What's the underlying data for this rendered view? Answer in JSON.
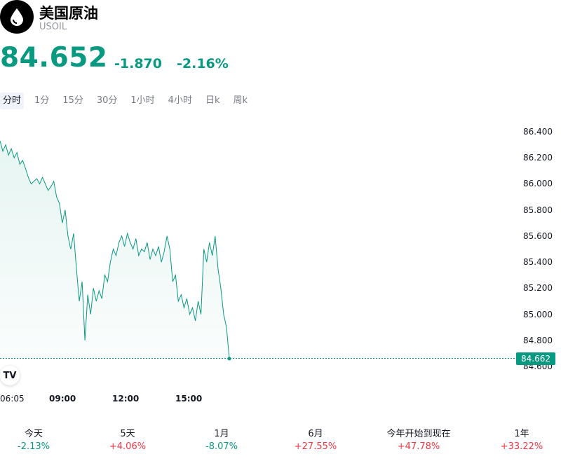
{
  "header": {
    "title": "美国原油",
    "symbol": "USOIL",
    "logo_icon": "oil-drop-icon"
  },
  "quote": {
    "price": "84.652",
    "change": "-1.870",
    "change_percent": "-2.16%",
    "color": "#089981"
  },
  "tabs": [
    {
      "label": "分时",
      "active": true
    },
    {
      "label": "1分",
      "active": false
    },
    {
      "label": "15分",
      "active": false
    },
    {
      "label": "30分",
      "active": false
    },
    {
      "label": "1小时",
      "active": false
    },
    {
      "label": "4小时",
      "active": false
    },
    {
      "label": "日k",
      "active": false
    },
    {
      "label": "周k",
      "active": false
    }
  ],
  "chart_data": {
    "type": "area",
    "line_color": "#089981",
    "y_ticks": [
      "86.400",
      "86.200",
      "86.000",
      "85.800",
      "85.600",
      "85.400",
      "85.200",
      "85.000",
      "84.800",
      "84.600"
    ],
    "ylim": [
      84.6,
      86.4
    ],
    "x_ticks": [
      {
        "label": "06:05",
        "bold": false
      },
      {
        "label": "09:00",
        "bold": true
      },
      {
        "label": "12:00",
        "bold": true
      },
      {
        "label": "15:00",
        "bold": true
      }
    ],
    "last_value": "84.662",
    "values": [
      86.33,
      86.25,
      86.3,
      86.22,
      86.27,
      86.2,
      86.24,
      86.15,
      86.18,
      86.12,
      86.05,
      86.0,
      86.02,
      86.04,
      86.0,
      86.05,
      86.0,
      85.95,
      85.98,
      86.02,
      85.9,
      85.85,
      85.7,
      85.8,
      85.6,
      85.5,
      85.62,
      85.35,
      85.1,
      85.25,
      84.8,
      85.15,
      85.0,
      85.2,
      85.1,
      85.18,
      85.12,
      85.3,
      85.25,
      85.4,
      85.5,
      85.45,
      85.55,
      85.6,
      85.52,
      85.62,
      85.55,
      85.5,
      85.58,
      85.45,
      85.5,
      85.48,
      85.55,
      85.42,
      85.5,
      85.45,
      85.52,
      85.4,
      85.48,
      85.6,
      85.5,
      85.25,
      85.3,
      85.1,
      85.15,
      85.05,
      85.12,
      85.0,
      85.05,
      84.95,
      85.1,
      85.0,
      85.5,
      85.4,
      85.55,
      85.45,
      85.6,
      85.35,
      85.2,
      85.0,
      84.9,
      84.66
    ]
  },
  "performance": [
    {
      "label": "今天",
      "value": "-2.13%",
      "dir": "neg"
    },
    {
      "label": "5天",
      "value": "+4.06%",
      "dir": "pos"
    },
    {
      "label": "1月",
      "value": "-8.07%",
      "dir": "neg"
    },
    {
      "label": "6月",
      "value": "+27.55%",
      "dir": "pos"
    },
    {
      "label": "今年开始到现在",
      "value": "+47.78%",
      "dir": "pos"
    },
    {
      "label": "1年",
      "value": "+33.22%",
      "dir": "pos"
    }
  ],
  "tradingview_logo_text": "TV"
}
